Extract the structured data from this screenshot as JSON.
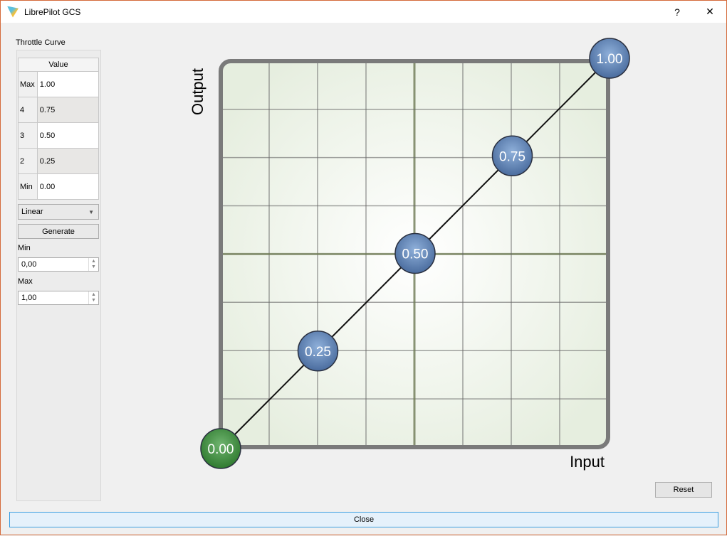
{
  "window": {
    "title": "LibrePilot GCS",
    "help": "?",
    "close": "✕"
  },
  "side": {
    "section_label": "Throttle Curve",
    "table": {
      "header": "Value",
      "rows": [
        {
          "label": "Max",
          "value": "1.00"
        },
        {
          "label": "4",
          "value": "0.75"
        },
        {
          "label": "3",
          "value": "0.50"
        },
        {
          "label": "2",
          "value": "0.25"
        },
        {
          "label": "Min",
          "value": "0.00"
        }
      ]
    },
    "curve_type": "Linear",
    "generate": "Generate",
    "min_label": "Min",
    "min_value": "0,00",
    "max_label": "Max",
    "max_value": "1,00"
  },
  "buttons": {
    "reset": "Reset",
    "close": "Close"
  },
  "chart_data": {
    "type": "line",
    "xlabel": "Input",
    "ylabel": "Output",
    "xlim": [
      0,
      1
    ],
    "ylim": [
      0,
      1
    ],
    "grid": true,
    "x": [
      0,
      0.25,
      0.5,
      0.75,
      1
    ],
    "y": [
      0,
      0.25,
      0.5,
      0.75,
      1
    ],
    "labels": [
      "0.00",
      "0.25",
      "0.50",
      "0.75",
      "1.00"
    ],
    "colors": {
      "first_point": "#3e8e3e",
      "points": "#5a7fb0"
    }
  }
}
